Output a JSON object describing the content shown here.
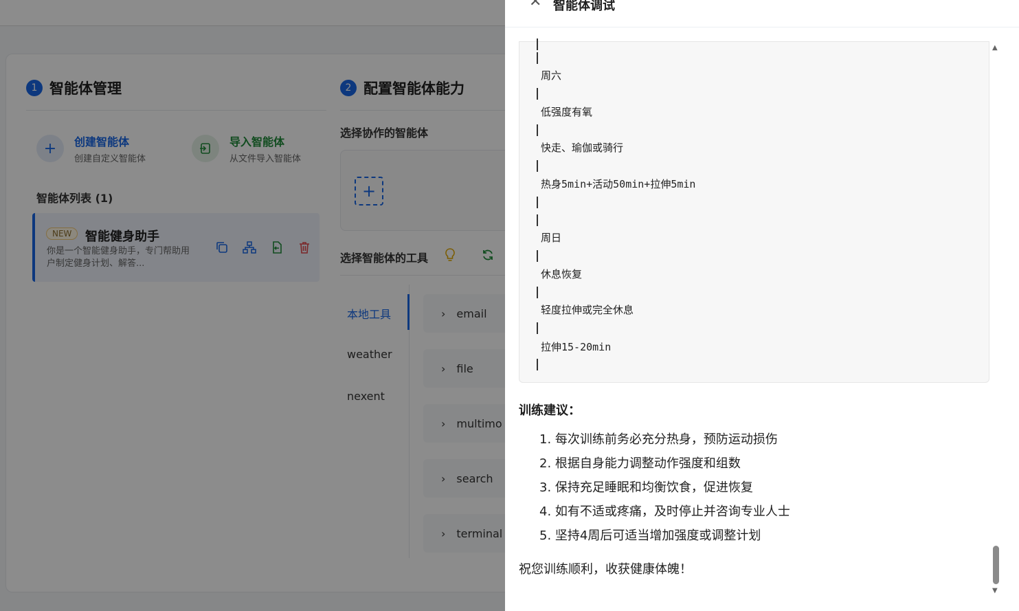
{
  "sections": {
    "manage": {
      "step": "1",
      "title": "智能体管理"
    },
    "config": {
      "step": "2",
      "title": "配置智能体能力"
    }
  },
  "actions": {
    "create": {
      "title": "创建智能体",
      "subtitle": "创建自定义智能体"
    },
    "import": {
      "title": "导入智能体",
      "subtitle": "从文件导入智能体"
    }
  },
  "agent_list": {
    "title": "智能体列表 (1)",
    "items": [
      {
        "badge": "NEW",
        "name": "智能健身助手",
        "description": "你是一个智能健身助手，专门帮助用户制定健身计划、解答..."
      }
    ]
  },
  "config": {
    "collab_label": "选择协作的智能体",
    "tools_label": "选择智能体的工具",
    "tool_tabs": [
      "本地工具",
      "weather",
      "nexent"
    ],
    "tools": [
      "email",
      "file",
      "multimo",
      "search",
      "terminal"
    ]
  },
  "drawer": {
    "title": "智能体调试",
    "code_lines": [
      "周六",
      "低强度有氧",
      "快走、瑜伽或骑行",
      "热身5min+活动50min+拉伸5min",
      "周日",
      "休息恢复",
      "轻度拉伸或完全休息",
      "拉伸15-20min"
    ],
    "advice_title": "训练建议：",
    "advice": [
      "1. 每次训练前务必充分热身，预防运动损伤",
      "2. 根据自身能力调整动作强度和组数",
      "3. 保持充足睡眠和均衡饮食，促进恢复",
      "4. 如有不适或疼痛，及时停止并咨询专业人士",
      "5. 坚持4周后可适当增加强度或调整计划"
    ],
    "closing": "祝您训练顺利，收获健康体魄！"
  },
  "colors": {
    "accent": "#1867e6",
    "green": "#1f8a3a",
    "danger": "#e0474c",
    "warning": "#e0a800"
  }
}
